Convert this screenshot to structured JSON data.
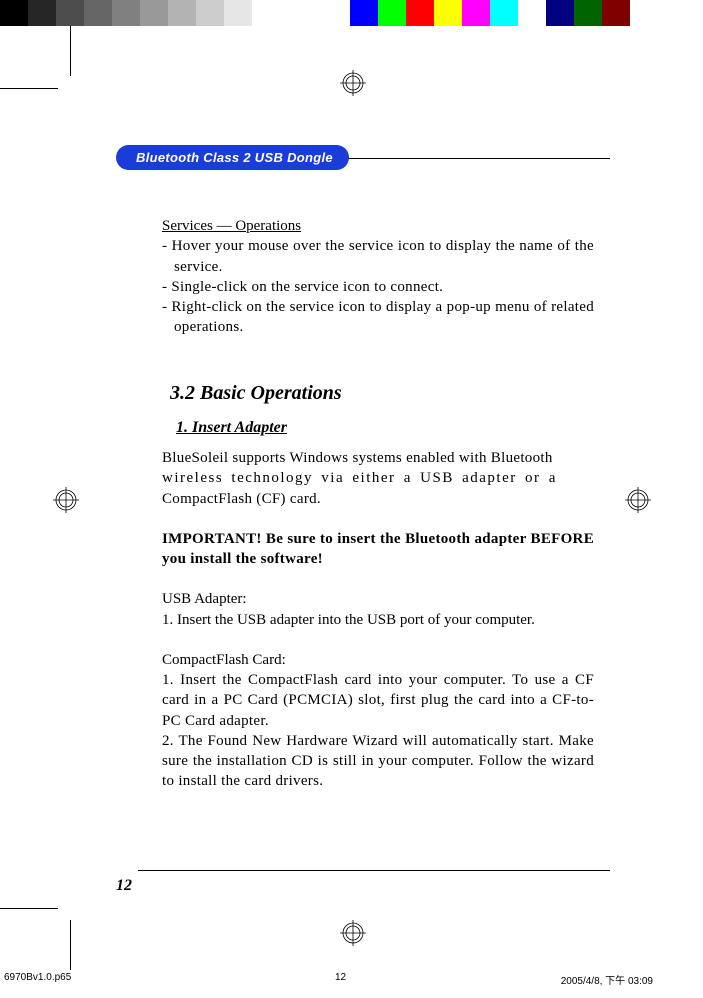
{
  "colorbar": [
    {
      "c": "#000000",
      "w": 28
    },
    {
      "c": "#262626",
      "w": 28
    },
    {
      "c": "#4d4d4d",
      "w": 28
    },
    {
      "c": "#666666",
      "w": 28
    },
    {
      "c": "#808080",
      "w": 28
    },
    {
      "c": "#999999",
      "w": 28
    },
    {
      "c": "#b3b3b3",
      "w": 28
    },
    {
      "c": "#cccccc",
      "w": 28
    },
    {
      "c": "#e6e6e6",
      "w": 28
    },
    {
      "c": "#ffffff",
      "w": 28
    },
    {
      "c": "#ffffff",
      "w": 70
    },
    {
      "c": "#0000ff",
      "w": 28
    },
    {
      "c": "#00ff00",
      "w": 28
    },
    {
      "c": "#ff0000",
      "w": 28
    },
    {
      "c": "#ffff00",
      "w": 28
    },
    {
      "c": "#ff00ff",
      "w": 28
    },
    {
      "c": "#00ffff",
      "w": 28
    },
    {
      "c": "#ffffff",
      "w": 28
    },
    {
      "c": "#000080",
      "w": 28
    },
    {
      "c": "#006400",
      "w": 28
    },
    {
      "c": "#800000",
      "w": 28
    },
    {
      "c": "#ffffff",
      "w": 50
    }
  ],
  "header": {
    "pill": "Bluetooth Class 2 USB Dongle"
  },
  "services": {
    "title": "Services — Operations",
    "items": [
      "- Hover your mouse over the service icon to display the name of the service.",
      "- Single-click on the service icon to connect.",
      "- Right-click on the service icon to display a pop-up menu of related operations."
    ]
  },
  "section": {
    "number": "3.2  Basic Operations",
    "sub": "1. Insert Adapter",
    "p1a": "BlueSoleil supports Windows systems enabled with Bluetooth",
    "p1b": "wireless technology via either a USB adapter or a",
    "p1c": "CompactFlash (CF) card.",
    "important": "IMPORTANT! Be sure to insert the Bluetooth adapter BEFORE you install the software!",
    "usb_h": "USB Adapter:",
    "usb_1": "1. Insert the USB adapter into the USB port of your computer.",
    "cf_h": "CompactFlash Card:",
    "cf_1": "1. Insert the CompactFlash card into your computer. To use a CF card in a PC Card (PCMCIA) slot, first plug the card into a CF-to-PC Card adapter.",
    "cf_2": "2. The Found New Hardware Wizard will automatically start. Make sure the installation CD is still in your computer. Follow the wizard to install the card drivers."
  },
  "page_number": "12",
  "footer": {
    "left": "6970Bv1.0.p65",
    "mid": "12",
    "right": "2005/4/8, 下午 03:09"
  }
}
